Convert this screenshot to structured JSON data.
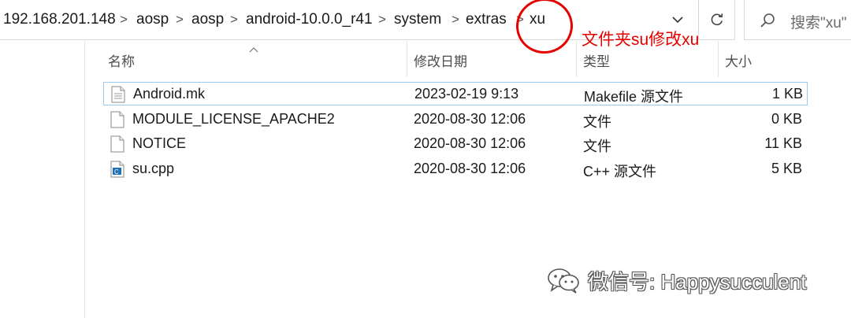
{
  "address_bar": {
    "crumbs": [
      "192.168.201.148",
      "aosp",
      "aosp",
      "android-10.0.0_r41",
      "system",
      "extras",
      "xu"
    ],
    "separator": ">"
  },
  "search": {
    "placeholder": "搜索\"xu\""
  },
  "annotation": {
    "text": "文件夹su修改xu",
    "color": "#e60000"
  },
  "columns": {
    "name": "名称",
    "date": "修改日期",
    "type": "类型",
    "size": "大小"
  },
  "files": [
    {
      "icon": "makefile-file-icon",
      "name": "Android.mk",
      "date": "2023-02-19 9:13",
      "type": "Makefile 源文件",
      "size": "1 KB",
      "selected": true
    },
    {
      "icon": "blank-file-icon",
      "name": "MODULE_LICENSE_APACHE2",
      "date": "2020-08-30 12:06",
      "type": "文件",
      "size": "0 KB"
    },
    {
      "icon": "blank-file-icon",
      "name": "NOTICE",
      "date": "2020-08-30 12:06",
      "type": "文件",
      "size": "11 KB"
    },
    {
      "icon": "cpp-file-icon",
      "name": "su.cpp",
      "date": "2020-08-30 12:06",
      "type": "C++ 源文件",
      "size": "5 KB"
    }
  ],
  "watermark": {
    "text": "微信号: Happysucculent",
    "icon": "wechat-icon"
  }
}
